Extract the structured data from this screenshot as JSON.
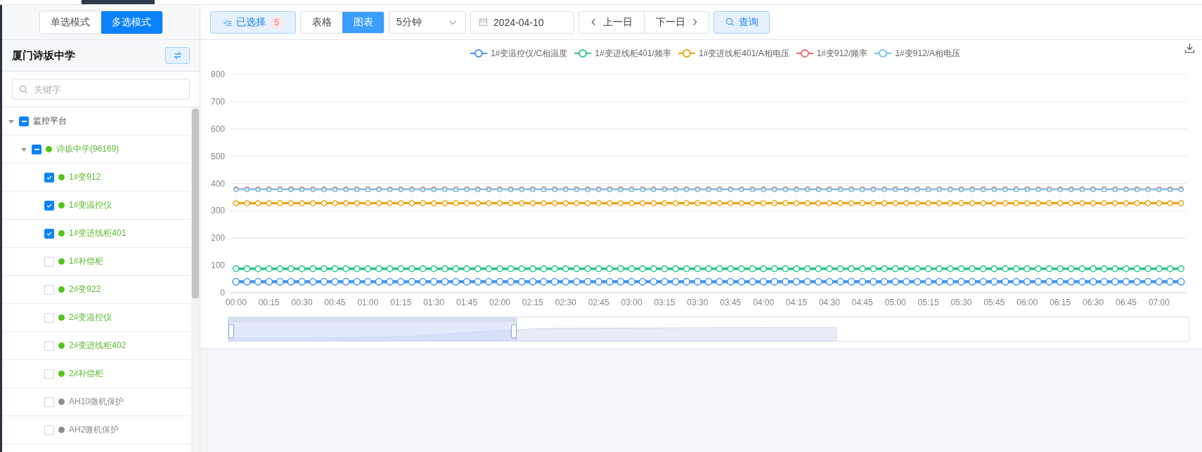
{
  "sidebar": {
    "mode_toggle": [
      {
        "label": "单选模式",
        "selected": false
      },
      {
        "label": "多选模式",
        "selected": true
      }
    ],
    "title": "厦门诗坂中学",
    "search": {
      "placeholder": "关键字"
    },
    "tree": [
      {
        "label": "监控平台",
        "expanded": true,
        "indeterminate": true,
        "children": [
          {
            "label": "诗坂中学(96169)",
            "color": "#52c41a",
            "expanded": true,
            "indeterminate": true,
            "children": [
              {
                "label": "1#变912",
                "color": "#52c41a",
                "checked": true
              },
              {
                "label": "1#变温控仪",
                "color": "#52c41a",
                "checked": true
              },
              {
                "label": "1#变进线柜401",
                "color": "#52c41a",
                "checked": true
              },
              {
                "label": "1#补偿柜",
                "color": "#52c41a",
                "checked": false
              },
              {
                "label": "2#变922",
                "color": "#52c41a",
                "checked": false
              },
              {
                "label": "2#变温控仪",
                "color": "#52c41a",
                "checked": false
              },
              {
                "label": "2#变进线柜402",
                "color": "#52c41a",
                "checked": false
              },
              {
                "label": "2#补偿柜",
                "color": "#52c41a",
                "checked": false
              },
              {
                "label": "AH10微机保护",
                "color": "#8c8c94",
                "checked": false
              },
              {
                "label": "AH2微机保护",
                "color": "#8c8c94",
                "checked": false
              }
            ]
          }
        ]
      }
    ]
  },
  "toolbar": {
    "selected_button": {
      "label": "已选择",
      "count": "5"
    },
    "view_toggle": [
      {
        "label": "表格",
        "selected": false
      },
      {
        "label": "图表",
        "selected": true
      }
    ],
    "interval_select": {
      "value": "5分钟"
    },
    "date_field": {
      "value": "2024-04-10"
    },
    "prev_day_button": "上一日",
    "next_day_button": "下一日",
    "query_button": "查询"
  },
  "chart": {
    "chart_data": {
      "type": "line",
      "grid": true,
      "xlim": [
        -2.5,
        432.5
      ],
      "ylim": [
        0,
        800
      ],
      "yticks": [
        0,
        100,
        200,
        300,
        400,
        500,
        600,
        700,
        800
      ],
      "x": [
        0,
        5,
        10,
        15,
        20,
        25,
        30,
        35,
        40,
        45,
        50,
        55,
        60,
        65,
        70,
        75,
        80,
        85,
        90,
        95,
        100,
        105,
        110,
        115,
        120,
        125,
        130,
        135,
        140,
        145,
        150,
        155,
        160,
        165,
        170,
        175,
        180,
        185,
        190,
        195,
        200,
        205,
        210,
        215,
        220,
        225,
        230,
        235,
        240,
        245,
        250,
        255,
        260,
        265,
        270,
        275,
        280,
        285,
        290,
        295,
        300,
        305,
        310,
        315,
        320,
        325,
        330,
        335,
        340,
        345,
        350,
        355,
        360,
        365,
        370,
        375,
        380,
        385,
        390,
        395,
        400,
        405,
        410,
        415,
        420,
        425,
        430
      ],
      "xticks": [
        {
          "value": 0,
          "label": "00:00"
        },
        {
          "value": 15,
          "label": "00:15"
        },
        {
          "value": 30,
          "label": "00:30"
        },
        {
          "value": 45,
          "label": "00:45"
        },
        {
          "value": 60,
          "label": "01:00"
        },
        {
          "value": 75,
          "label": "01:15"
        },
        {
          "value": 90,
          "label": "01:30"
        },
        {
          "value": 105,
          "label": "01:45"
        },
        {
          "value": 120,
          "label": "02:00"
        },
        {
          "value": 135,
          "label": "02:15"
        },
        {
          "value": 150,
          "label": "02:30"
        },
        {
          "value": 165,
          "label": "02:45"
        },
        {
          "value": 180,
          "label": "03:00"
        },
        {
          "value": 195,
          "label": "03:15"
        },
        {
          "value": 210,
          "label": "03:30"
        },
        {
          "value": 225,
          "label": "03:45"
        },
        {
          "value": 240,
          "label": "04:00"
        },
        {
          "value": 255,
          "label": "04:15"
        },
        {
          "value": 270,
          "label": "04:30"
        },
        {
          "value": 285,
          "label": "04:45"
        },
        {
          "value": 300,
          "label": "05:00"
        },
        {
          "value": 315,
          "label": "05:15"
        },
        {
          "value": 330,
          "label": "05:30"
        },
        {
          "value": 345,
          "label": "05:45"
        },
        {
          "value": 360,
          "label": "06:00"
        },
        {
          "value": 375,
          "label": "06:15"
        },
        {
          "value": 390,
          "label": "06:30"
        },
        {
          "value": 405,
          "label": "06:45"
        },
        {
          "value": 420,
          "label": "07:00"
        }
      ],
      "series": [
        {
          "name": "1#变温控仪/C相温度",
          "color": "#3f95f7",
          "marker": "circle",
          "values": [
            40,
            40,
            40,
            40,
            40,
            40,
            40,
            40,
            40,
            40,
            40,
            40,
            40,
            40,
            40,
            40,
            40,
            40,
            40,
            40,
            40,
            40,
            40,
            40,
            40,
            40,
            40,
            40,
            40,
            40,
            40,
            40,
            40,
            40,
            40,
            40,
            40,
            40,
            40,
            40,
            40,
            40,
            40,
            40,
            40,
            40,
            40,
            40,
            40,
            40,
            40,
            40,
            40,
            40,
            40,
            40,
            40,
            40,
            40,
            40,
            40,
            40,
            40,
            40,
            40,
            40,
            40,
            40,
            40,
            40,
            40,
            40,
            40,
            40,
            40,
            40,
            40,
            40,
            40,
            40,
            40,
            40,
            40,
            40,
            40,
            40,
            40
          ]
        },
        {
          "name": "1#变进线柜401/频率",
          "color": "#2dc887",
          "marker": "circle",
          "values": [
            88,
            88,
            88,
            88,
            88,
            88,
            88,
            88,
            88,
            88,
            88,
            88,
            88,
            88,
            88,
            88,
            88,
            88,
            88,
            88,
            88,
            88,
            88,
            88,
            88,
            88,
            88,
            88,
            88,
            88,
            88,
            88,
            88,
            88,
            88,
            88,
            88,
            88,
            88,
            88,
            88,
            88,
            88,
            88,
            88,
            88,
            88,
            88,
            88,
            88,
            88,
            88,
            88,
            88,
            88,
            88,
            88,
            88,
            88,
            88,
            88,
            88,
            88,
            88,
            88,
            88,
            88,
            88,
            88,
            88,
            88,
            88,
            88,
            88,
            88,
            88,
            88,
            88,
            88,
            88,
            88,
            88,
            88,
            88,
            88,
            88,
            88
          ]
        },
        {
          "name": "1#变进线柜401/A相电压",
          "color": "#eea20b",
          "marker": "circle",
          "values": [
            328,
            328,
            328,
            328,
            328,
            328,
            328,
            328,
            328,
            328,
            328,
            328,
            328,
            328,
            328,
            328,
            328,
            328,
            328,
            328,
            328,
            328,
            328,
            328,
            328,
            328,
            328,
            328,
            328,
            328,
            328,
            328,
            328,
            328,
            328,
            328,
            328,
            328,
            328,
            328,
            328,
            328,
            328,
            328,
            328,
            328,
            328,
            328,
            328,
            328,
            328,
            328,
            328,
            328,
            328,
            328,
            328,
            328,
            328,
            328,
            328,
            328,
            328,
            328,
            328,
            328,
            328,
            328,
            328,
            328,
            328,
            328,
            328,
            328,
            328,
            328,
            328,
            328,
            328,
            328,
            328,
            328,
            328,
            328,
            328,
            328,
            328
          ]
        },
        {
          "name": "1#变912/频率",
          "color": "#f26b6b",
          "marker": "circle",
          "values": [
            379,
            379,
            379,
            379,
            379,
            379,
            379,
            379,
            379,
            379,
            379,
            379,
            379,
            379,
            379,
            379,
            379,
            379,
            379,
            379,
            379,
            379,
            379,
            379,
            379,
            379,
            379,
            379,
            379,
            379,
            379,
            379,
            379,
            379,
            379,
            379,
            379,
            379,
            379,
            379,
            379,
            379,
            379,
            379,
            379,
            379,
            379,
            379,
            379,
            379,
            379,
            379,
            379,
            379,
            379,
            379,
            379,
            379,
            379,
            379,
            379,
            379,
            379,
            379,
            379,
            379,
            379,
            379,
            379,
            379,
            379,
            379,
            379,
            379,
            379,
            379,
            379,
            379,
            379,
            379,
            379,
            379,
            379,
            379,
            379,
            379,
            379
          ]
        },
        {
          "name": "1#变912/A相电压",
          "color": "#72c8ef",
          "marker": "circle",
          "values": [
            378,
            378,
            378,
            378,
            378,
            378,
            378,
            378,
            378,
            378,
            378,
            378,
            378,
            378,
            378,
            378,
            378,
            378,
            378,
            378,
            378,
            378,
            378,
            378,
            378,
            378,
            378,
            378,
            378,
            378,
            378,
            378,
            378,
            378,
            378,
            378,
            378,
            378,
            378,
            378,
            378,
            378,
            378,
            378,
            378,
            378,
            378,
            378,
            378,
            378,
            378,
            378,
            378,
            378,
            378,
            378,
            378,
            378,
            378,
            378,
            378,
            378,
            378,
            378,
            378,
            378,
            378,
            378,
            378,
            378,
            378,
            378,
            378,
            378,
            378,
            378,
            378,
            378,
            378,
            378,
            378,
            378,
            378,
            378,
            378,
            378,
            378
          ]
        }
      ]
    },
    "zoom_slider": {
      "level": 0.3
    }
  }
}
